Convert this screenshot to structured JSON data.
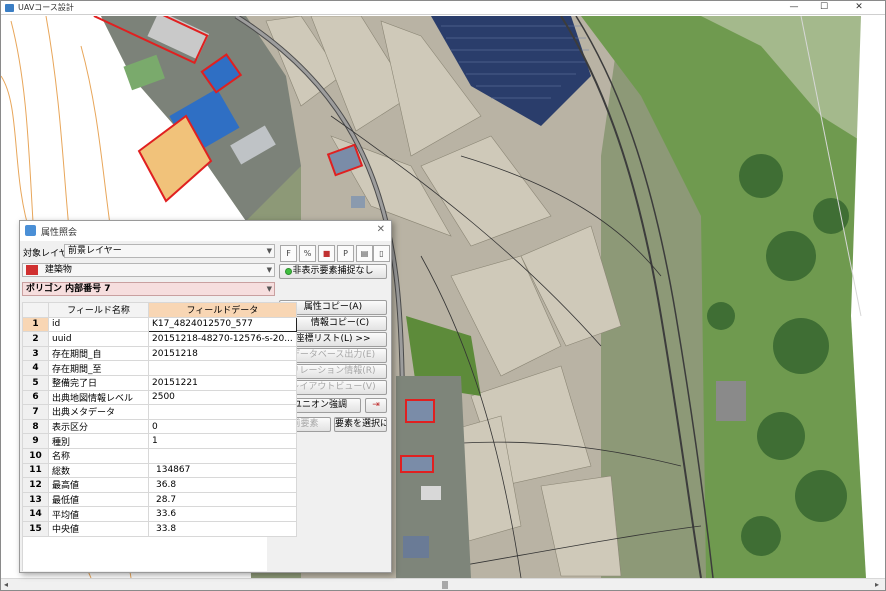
{
  "window": {
    "title": "UAVコース設計",
    "buttons": {
      "minimize": "—",
      "maximize": "☐",
      "close": "✕"
    }
  },
  "scrollbar": {
    "left_arrow": "◂",
    "right_arrow": "▸"
  },
  "dialog": {
    "title": "属性照会",
    "close": "✕",
    "layer_label": "対象レイヤ",
    "layer_value": "前景レイヤー",
    "category_value": "建築物",
    "polygon_value": "ポリゴン 内部番号 7",
    "toolbar": [
      "F",
      "%",
      "■",
      "P",
      "▤",
      "▯"
    ],
    "hidden_toggle": "非表示要素捕捉なし",
    "columns": {
      "name": "フィールド名称",
      "data": "フィールドデータ"
    },
    "rows": [
      {
        "n": "1",
        "name": "id",
        "value": "K17_4824012570_577"
      },
      {
        "n": "2",
        "name": "uuid",
        "value": "20151218-48270-12576-s-20..."
      },
      {
        "n": "3",
        "name": "存在期間_自",
        "value": "20151218"
      },
      {
        "n": "4",
        "name": "存在期間_至",
        "value": ""
      },
      {
        "n": "5",
        "name": "整備完了日",
        "value": "20151221"
      },
      {
        "n": "6",
        "name": "出典地図情報レベル",
        "value": "2500"
      },
      {
        "n": "7",
        "name": "出典メタデータ",
        "value": ""
      },
      {
        "n": "8",
        "name": "表示区分",
        "value": "0"
      },
      {
        "n": "9",
        "name": "種別",
        "value": "1"
      },
      {
        "n": "10",
        "name": "名称",
        "value": ""
      },
      {
        "n": "11",
        "name": "総数",
        "value": "134867"
      },
      {
        "n": "12",
        "name": "最高値",
        "value": "36.8"
      },
      {
        "n": "13",
        "name": "最低値",
        "value": "28.7"
      },
      {
        "n": "14",
        "name": "平均値",
        "value": "33.6"
      },
      {
        "n": "15",
        "name": "中央値",
        "value": "33.8"
      }
    ],
    "buttons": {
      "attr_copy": "属性コピー(A)",
      "info_copy": "情報コピー(C)",
      "coord_list": "座標リスト(L) >>",
      "db_export": "データベース出力(E)",
      "relation": "リレーション情報(R)",
      "layout_view": "レイアウトビュー(V)",
      "union": "ユニオン強調",
      "prev": "前要素",
      "select": "要素を選択に"
    }
  }
}
